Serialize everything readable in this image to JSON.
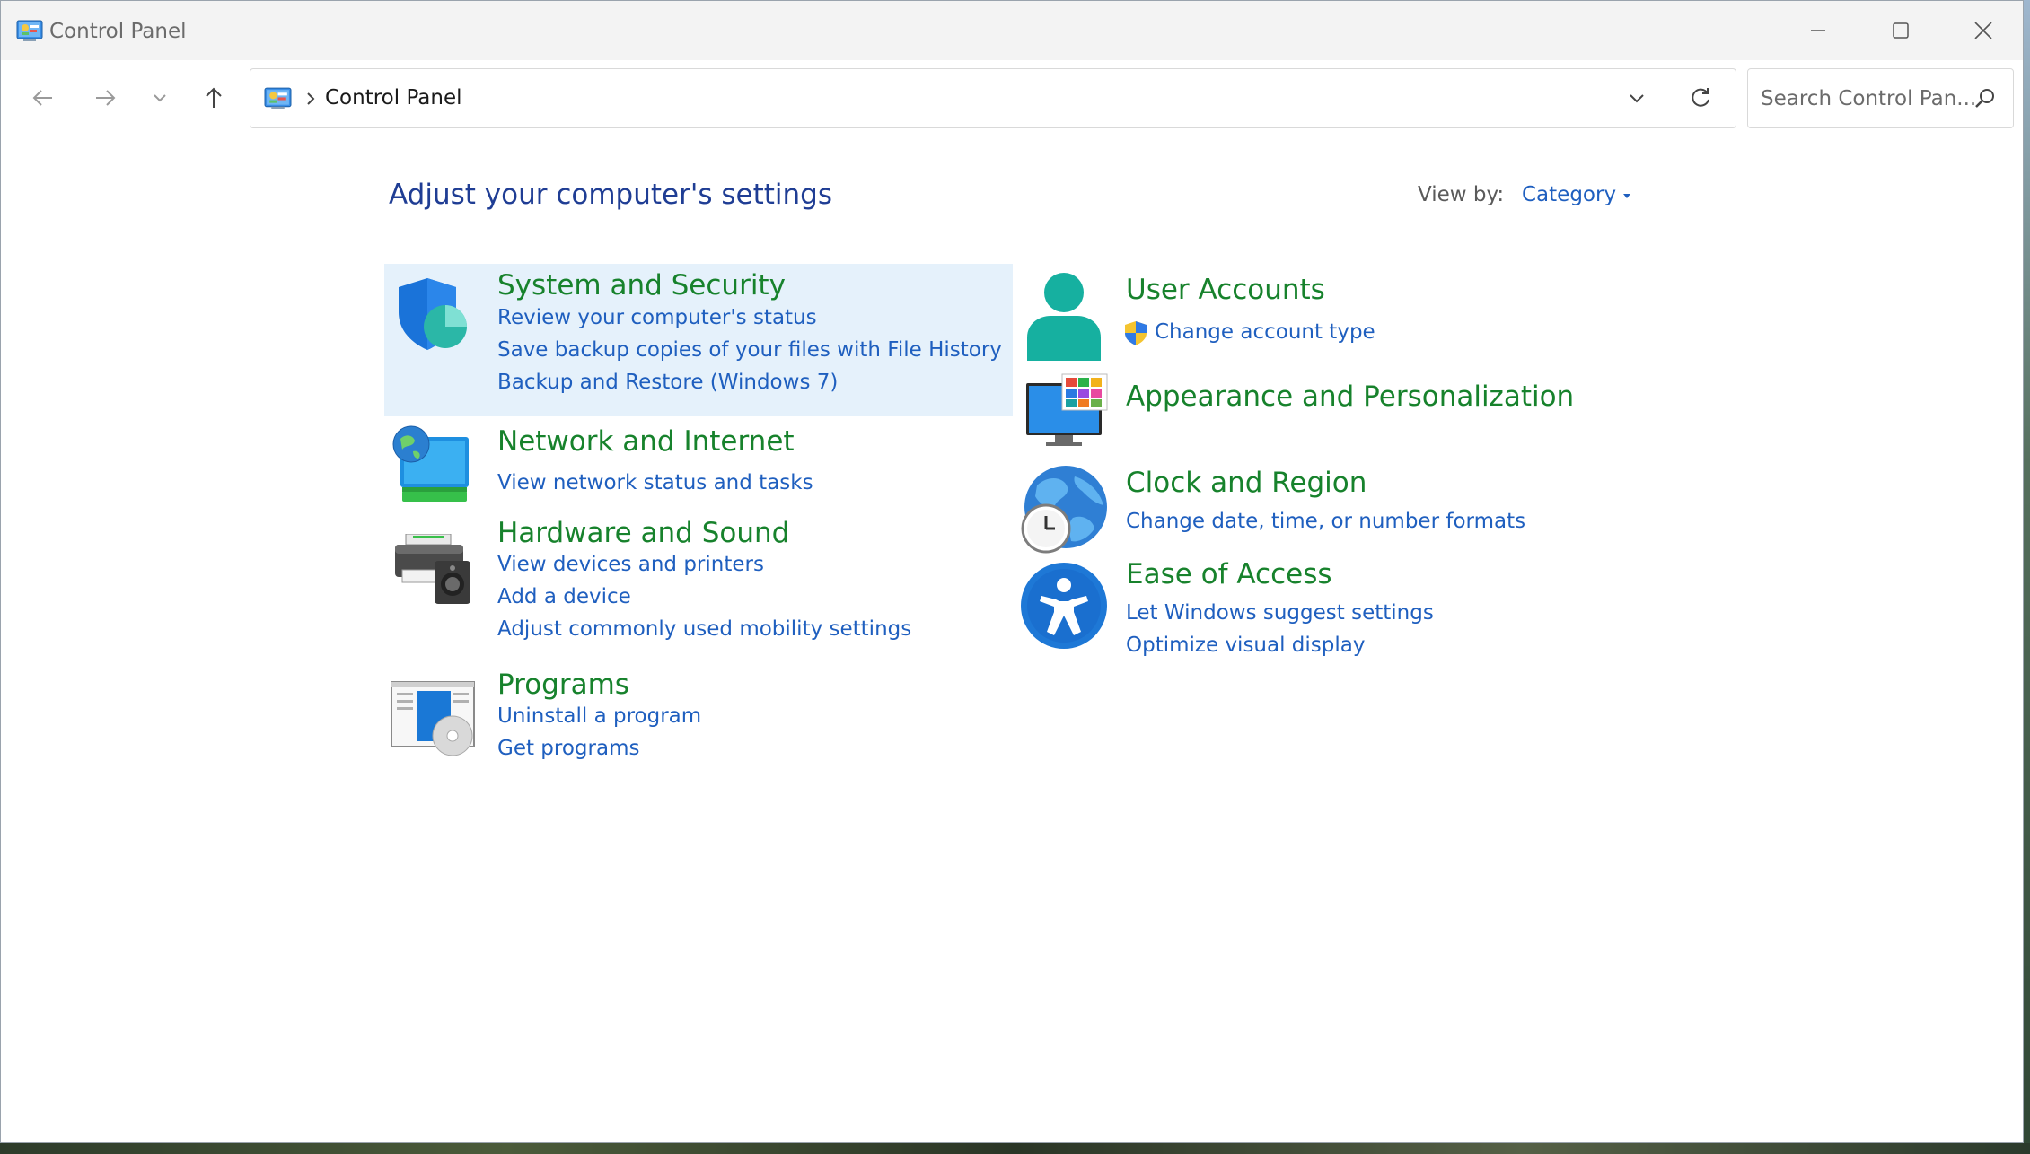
{
  "window": {
    "title": "Control Panel",
    "minimize_label": "Minimize",
    "maximize_label": "Maximize",
    "close_label": "Close"
  },
  "address": {
    "breadcrumb": "Control Panel"
  },
  "search": {
    "placeholder": "Search Control Pan..."
  },
  "page": {
    "title": "Adjust your computer's settings",
    "view_by_label": "View by:",
    "view_by_value": "Category"
  },
  "categories": [
    {
      "title": "System and Security",
      "icon": "shield-icon",
      "links": [
        "Review your computer's status",
        "Save backup copies of your files with File History",
        "Backup and Restore (Windows 7)"
      ]
    },
    {
      "title": "Network and Internet",
      "icon": "network-globe-icon",
      "links": [
        "View network status and tasks"
      ]
    },
    {
      "title": "Hardware and Sound",
      "icon": "printer-speaker-icon",
      "links": [
        "View devices and printers",
        "Add a device",
        "Adjust commonly used mobility settings"
      ]
    },
    {
      "title": "Programs",
      "icon": "programs-disc-icon",
      "links": [
        "Uninstall a program",
        "Get programs"
      ]
    },
    {
      "title": "User Accounts",
      "icon": "user-icon",
      "links": [
        "Change account type"
      ]
    },
    {
      "title": "Appearance and Personalization",
      "icon": "monitor-palette-icon",
      "links": []
    },
    {
      "title": "Clock and Region",
      "icon": "globe-clock-icon",
      "links": [
        "Change date, time, or number formats"
      ]
    },
    {
      "title": "Ease of Access",
      "icon": "accessibility-icon",
      "links": [
        "Let Windows suggest settings",
        "Optimize visual display"
      ]
    }
  ],
  "colors": {
    "category_title": "#17822c",
    "link": "#1f5fbf",
    "page_title": "#1f3d94",
    "highlight": "#e5f1fb"
  }
}
